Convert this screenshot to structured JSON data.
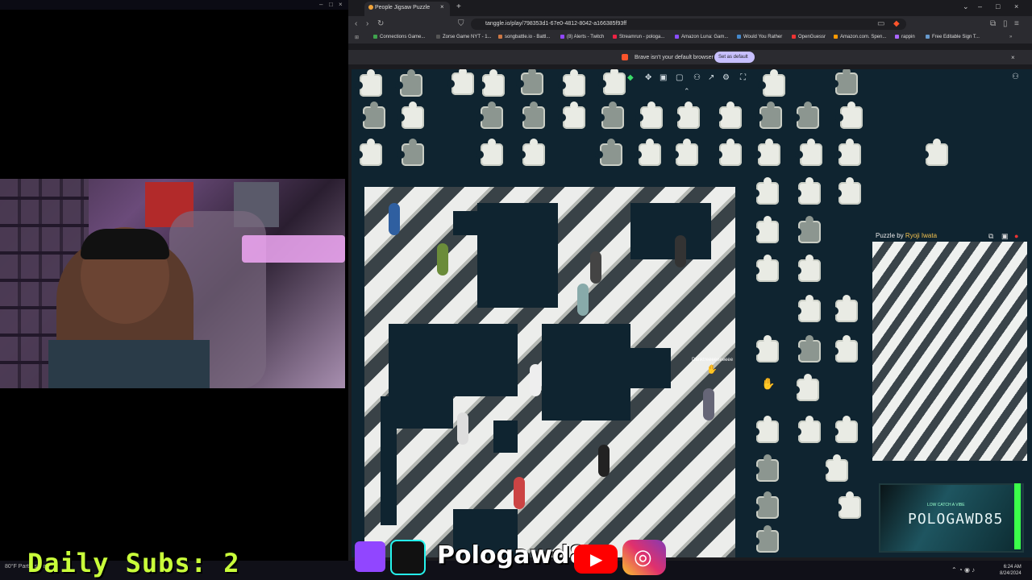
{
  "browser": {
    "tab_title": "People Jigsaw Puzzle",
    "url": "tanggle.io/play/798353d1-67e0-4812-8042-a166385f93ff",
    "bookmarks": [
      "Connections Game...",
      "Zorse Game NYT - 1...",
      "songbattle.io - Battl...",
      "(8) Alerts - Twitch",
      "Streamrun - pologa...",
      "Amazon Luna: Gam...",
      "Would You Rather",
      "OpenGuessr",
      "Amazon.com. Spen...",
      "rappin",
      "Free Editable Sign T..."
    ],
    "notice_text": "Brave isn't your default browser",
    "set_default_label": "Set as default"
  },
  "puzzle": {
    "ref_label": "Puzzle by",
    "ref_author": "Ryoji Iwata",
    "cursor_user": "Danktreeeeeeeeee"
  },
  "stream": {
    "daily_subs": "Daily Subs:  2",
    "social_handle": "Pologawd85",
    "card_small": "LOW CATCH A VIBE",
    "card_name": "POLOGAWD85",
    "weather": "80°F Partly sunny"
  },
  "system": {
    "time": "6:24 AM",
    "date": "8/24/2024"
  },
  "colors": {
    "subs_green": "#c9ff3a",
    "author_gold": "#f2c14e",
    "canvas_bg": "#0f2430",
    "twitch_purple": "#9146ff",
    "youtube_red": "#ff0000"
  }
}
